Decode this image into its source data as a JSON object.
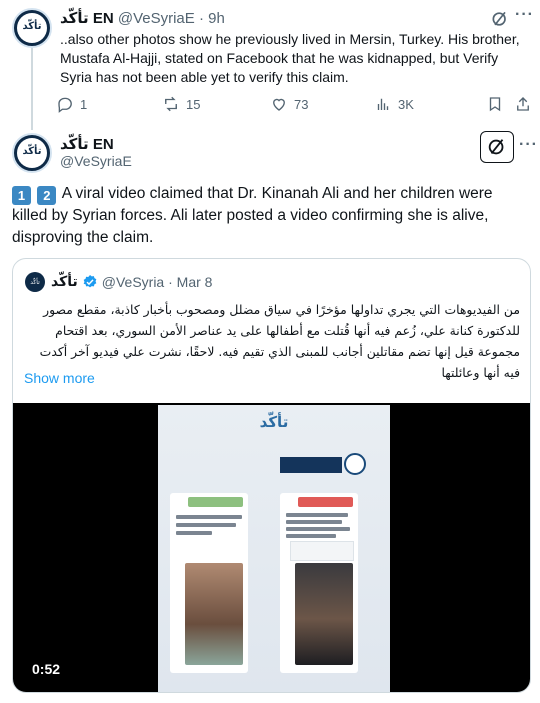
{
  "tweet1": {
    "display_name_latin": "EN",
    "display_name_arabic": "تأكّد",
    "handle": "@VeSyriaE",
    "time": "9h",
    "body": "..also other photos show he previously lived in Mersin, Turkey. His brother, Mustafa Al-Hajji, stated on Facebook that he was kidnapped, but Verify Syria has not been able yet to verify this claim.",
    "metrics": {
      "replies": "1",
      "reposts": "15",
      "likes": "73",
      "views": "3K"
    }
  },
  "tweet2": {
    "display_name_latin": "EN",
    "display_name_arabic": "تأكّد",
    "handle": "@VeSyriaE",
    "keycaps": [
      "1",
      "2"
    ],
    "body": "A viral video claimed that Dr. Kinanah Ali and her children were killed by Syrian forces. Ali later posted a video confirming she is alive, disproving the claim."
  },
  "quote": {
    "display_name": "تأكّد",
    "handle": "@VeSyria",
    "date": "Mar 8",
    "body": "من الفيديوهات التي يجري تداولها مؤخرًا في سياق مضلل ومصحوب بأخبار كاذبة، مقطع مصور للدكتورة كنانة علي، زُعم فيه أنها قُتلت مع أطفالها على يد عناصر الأمن السوري، بعد اقتحام مجموعة قيل إنها تضم مقاتلين أجانب للمبنى الذي تقيم فيه. لاحقًا، نشرت علي فيديو آخر أكدت فيه أنها وعائلتها",
    "show_more": "Show more",
    "video_duration": "0:52"
  },
  "avatar_text": "تأكّد",
  "colors": {
    "link": "#1d9bf0",
    "muted": "#536471",
    "border": "#cfd9de",
    "keycap": "#3b88c3"
  }
}
